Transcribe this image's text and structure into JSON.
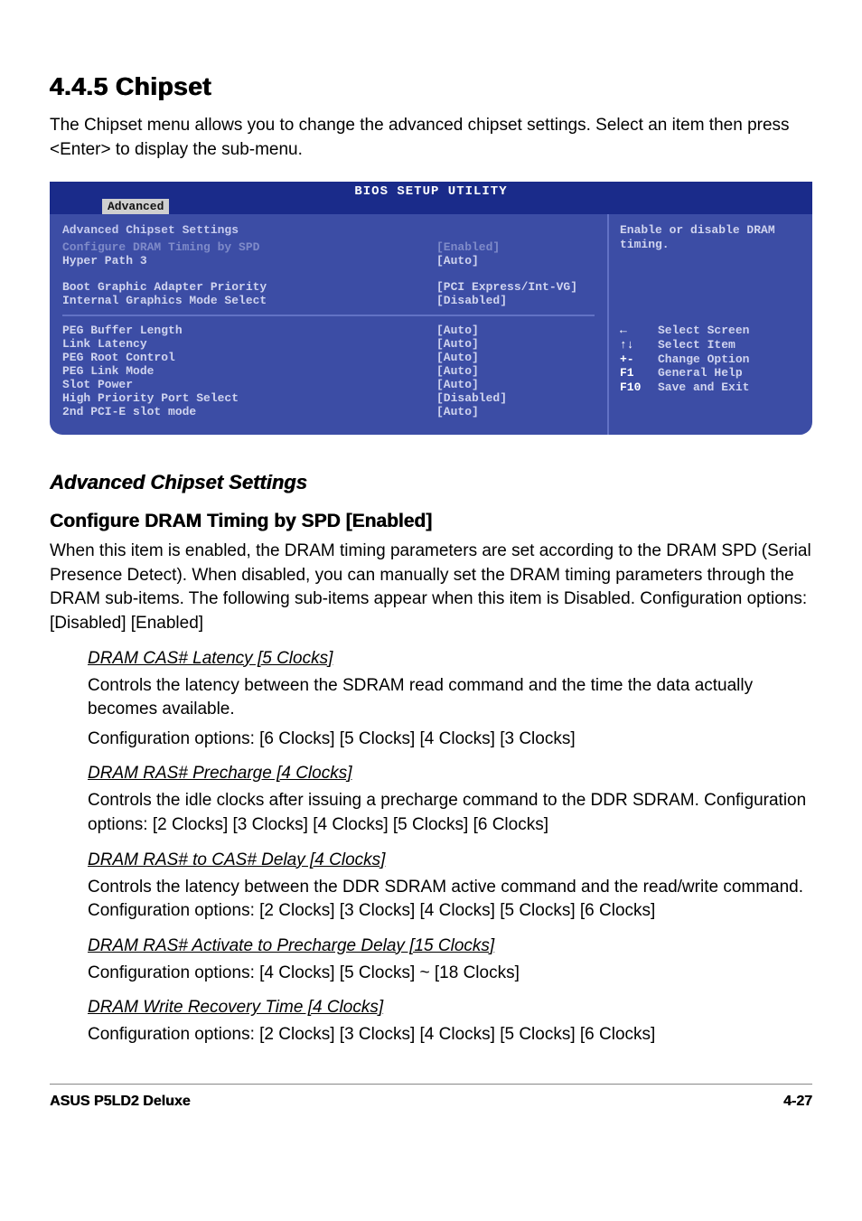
{
  "heading": "4.4.5   Chipset",
  "intro": "The Chipset menu allows you to change the advanced chipset settings. Select an item then press <Enter> to display the sub-menu.",
  "bios": {
    "title": "BIOS SETUP UTILITY",
    "tab": "Advanced",
    "group_title": "Advanced Chipset Settings",
    "group1": [
      {
        "label": "Configure DRAM Timing by SPD",
        "value": "[Enabled]",
        "dim": true
      },
      {
        "label": "Hyper Path 3",
        "value": "[Auto]",
        "dim": false
      }
    ],
    "group2": [
      {
        "label": "Boot Graphic Adapter Priority",
        "value": "[PCI Express/Int-VG]"
      },
      {
        "label": "Internal Graphics Mode Select",
        "value": "[Disabled]"
      }
    ],
    "group3": [
      {
        "label": "PEG Buffer Length",
        "value": "[Auto]"
      },
      {
        "label": "Link Latency",
        "value": "[Auto]"
      },
      {
        "label": "PEG Root Control",
        "value": "[Auto]"
      },
      {
        "label": "PEG Link Mode",
        "value": "[Auto]"
      },
      {
        "label": "Slot Power",
        "value": "[Auto]"
      },
      {
        "label": "High Priority Port Select",
        "value": "[Disabled]"
      },
      {
        "label": "2nd PCI-E slot mode",
        "value": "[Auto]"
      }
    ],
    "help": "Enable or disable DRAM timing.",
    "legend": [
      {
        "key": "←",
        "desc": "Select Screen"
      },
      {
        "key": "↑↓",
        "desc": "Select Item"
      },
      {
        "key": "+-",
        "desc": "Change Option"
      },
      {
        "key": "F1",
        "desc": "General Help"
      },
      {
        "key": "F10",
        "desc": "Save and Exit"
      }
    ]
  },
  "subsection": "Advanced Chipset Settings",
  "item_heading": "Configure DRAM Timing by SPD [Enabled]",
  "item_body": "When this item is enabled, the DRAM timing parameters are set according to the DRAM SPD (Serial Presence Detect). When disabled, you can manually set the DRAM timing parameters through the DRAM sub-items. The following sub-items appear when this item is Disabled. Configuration options: [Disabled] [Enabled]",
  "subitems": [
    {
      "title": "DRAM CAS# Latency [5 Clocks]",
      "body": "Controls the latency between the SDRAM read command and the time the data actually becomes available.",
      "opts": "Configuration options: [6 Clocks] [5 Clocks] [4 Clocks] [3 Clocks]"
    },
    {
      "title": "DRAM RAS# Precharge [4 Clocks]",
      "body": "Controls the idle clocks after issuing a precharge command to the DDR SDRAM. Configuration options: [2 Clocks] [3 Clocks] [4 Clocks] [5 Clocks] [6 Clocks]",
      "opts": ""
    },
    {
      "title": "DRAM RAS# to CAS# Delay [4 Clocks]",
      "body": "Controls the latency between the DDR SDRAM active command and the read/write command. Configuration options: [2 Clocks] [3 Clocks] [4 Clocks] [5 Clocks] [6 Clocks]",
      "opts": ""
    },
    {
      "title": "DRAM RAS# Activate to Precharge Delay [15 Clocks]",
      "body": "Configuration options: [4 Clocks] [5 Clocks] ~ [18 Clocks]",
      "opts": ""
    },
    {
      "title": "DRAM Write Recovery Time [4 Clocks]",
      "body": "Configuration options: [2 Clocks] [3 Clocks] [4 Clocks] [5 Clocks] [6 Clocks]",
      "opts": ""
    }
  ],
  "footer": {
    "left": "ASUS P5LD2 Deluxe",
    "right": "4-27"
  }
}
